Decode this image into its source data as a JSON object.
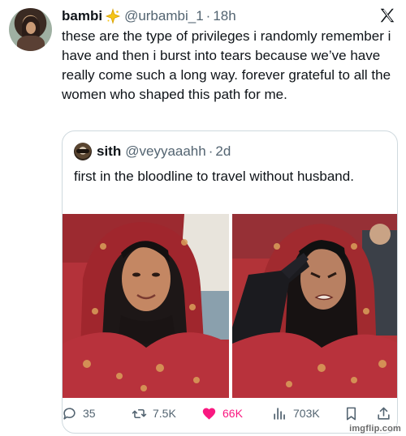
{
  "author": {
    "name": "bambi",
    "handle": "@urbambi_1",
    "separator": "·",
    "time": "18h",
    "text": "these are the type of privileges i randomly remember i have and then i burst into tears because we’ve have really come such a long way. forever grateful to all the women who shaped this path for me."
  },
  "quote": {
    "name": "sith",
    "handle": "@veyyaaahh",
    "separator": "·",
    "time": "2d",
    "text": "first in the bloodline to travel without husband."
  },
  "actions": {
    "replies": "35",
    "reposts": "7.5K",
    "likes": "66K",
    "views": "703K"
  },
  "colors": {
    "like": "#f91880",
    "muted": "#536471",
    "border": "#cfd9de"
  },
  "icons": [
    "sparkle-verified-icon",
    "x-logo-icon",
    "reply-icon",
    "repost-icon",
    "heart-icon",
    "views-icon",
    "bookmark-icon",
    "share-icon"
  ],
  "watermark": "imgflip.com"
}
